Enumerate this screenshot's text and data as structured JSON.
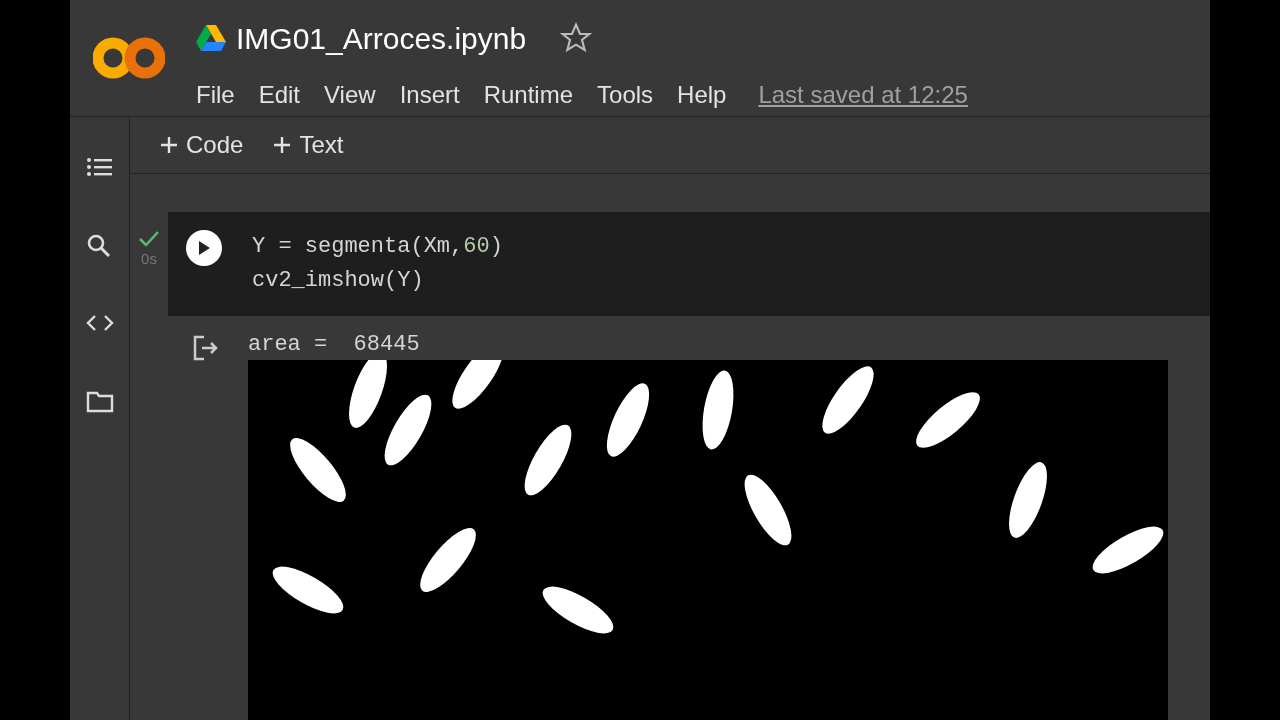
{
  "notebook": {
    "title": "IMG01_Arroces.ipynb",
    "starred": false,
    "last_saved": "Last saved at 12:25"
  },
  "menu": [
    "File",
    "Edit",
    "View",
    "Insert",
    "Runtime",
    "Tools",
    "Help"
  ],
  "toolbar": [
    {
      "label": "Code"
    },
    {
      "label": "Text"
    }
  ],
  "sidebar": [
    {
      "kind": "toc"
    },
    {
      "kind": "search"
    },
    {
      "kind": "code"
    },
    {
      "kind": "files"
    }
  ],
  "cell": {
    "completed": true,
    "duration": "0s",
    "lines": [
      [
        {
          "kind": "plain",
          "text": "Y = segmenta(Xm,"
        },
        {
          "kind": "number",
          "text": "60"
        },
        {
          "kind": "plain",
          "text": ")"
        }
      ],
      [
        {
          "kind": "plain",
          "text": "cv2_imshow(Y)"
        }
      ]
    ],
    "output": {
      "text": "area =  68445"
    }
  }
}
